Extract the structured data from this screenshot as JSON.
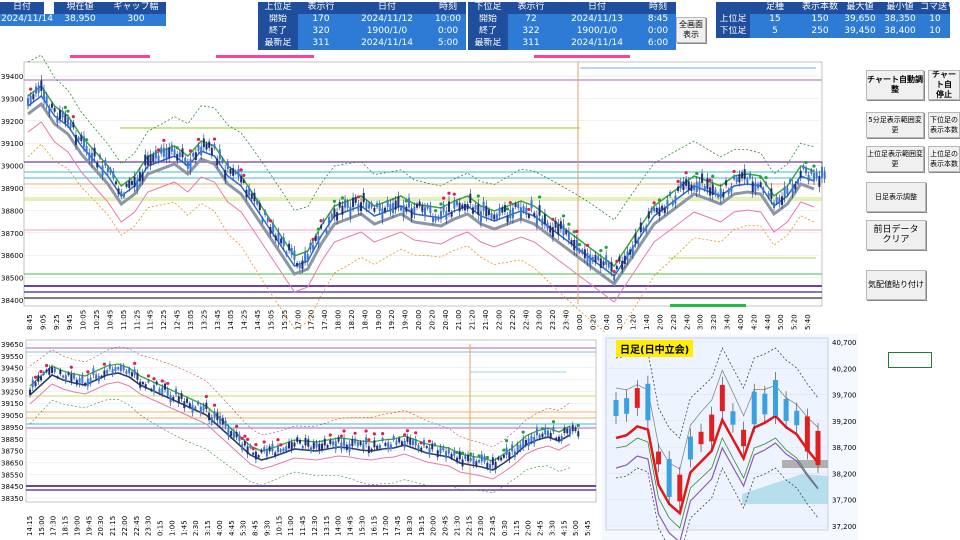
{
  "summary": {
    "headers": [
      "日付",
      "現在値",
      "ギャップ幅"
    ],
    "values": [
      "2024/11/14",
      "38,950",
      "300"
    ]
  },
  "upper": {
    "headers": [
      "上位足",
      "表示行",
      "日付",
      "時刻"
    ],
    "rows": [
      [
        "開始",
        "170",
        "2024/11/12",
        "10:00"
      ],
      [
        "終了",
        "320",
        "1900/1/0",
        "0:00"
      ],
      [
        "最新足",
        "311",
        "2024/11/14",
        "5:00"
      ]
    ]
  },
  "lower": {
    "headers": [
      "下位足",
      "表示行",
      "日付",
      "時刻"
    ],
    "rows": [
      [
        "開始",
        "72",
        "2024/11/13",
        "8:45"
      ],
      [
        "終了",
        "322",
        "1900/1/0",
        "0:00"
      ],
      [
        "最新足",
        "311",
        "2024/11/14",
        "6:00"
      ]
    ]
  },
  "fullscreen_button": [
    "全画面",
    "表示"
  ],
  "ashi": {
    "headers": [
      "足種",
      "表示本数",
      "最大値",
      "最小値",
      "コマ送り本数"
    ],
    "rows": [
      [
        "上位足",
        "15",
        "150",
        "39,650",
        "38,350",
        "10"
      ],
      [
        "下位足",
        "5",
        "250",
        "39,450",
        "38,400",
        "10"
      ]
    ]
  },
  "side_buttons": {
    "chart_auto": "チャート自動調整",
    "chart_auto_stop": [
      "チャート自",
      "停止"
    ],
    "range_5min": "5分足表示範囲変更",
    "lower_range": [
      "下位足の",
      "表示本数"
    ],
    "upper_range": "上位足表示範囲変更",
    "upper_range2": [
      "上位足の",
      "表示本数"
    ],
    "daily_adjust": "日足表示調整",
    "prev_day": [
      "前日データ",
      "クリア"
    ],
    "paste_quote": "気配値貼り付け"
  },
  "chart_top": {
    "y_ticks": [
      "39400",
      "39300",
      "39200",
      "39100",
      "39000",
      "38900",
      "38800",
      "38700",
      "38600",
      "38500",
      "38400"
    ],
    "x_ticks": [
      "8:45",
      "9:05",
      "9:25",
      "9:45",
      "10:05",
      "10:25",
      "10:45",
      "11:05",
      "11:25",
      "11:45",
      "12:25",
      "12:45",
      "13:05",
      "13:25",
      "13:45",
      "14:05",
      "14:25",
      "14:45",
      "15:05",
      "15:25",
      "17:00",
      "17:20",
      "17:40",
      "18:00",
      "18:20",
      "18:40",
      "19:00",
      "19:20",
      "19:40",
      "20:00",
      "20:20",
      "20:40",
      "21:00",
      "21:20",
      "21:40",
      "22:00",
      "22:20",
      "22:40",
      "23:00",
      "23:20",
      "23:40",
      "0:00",
      "0:20",
      "0:40",
      "1:00",
      "1:20",
      "1:40",
      "2:00",
      "2:20",
      "2:40",
      "3:00",
      "3:20",
      "3:40",
      "4:00",
      "4:20",
      "4:40",
      "5:00",
      "5:20",
      "5:40"
    ]
  },
  "chart_bottom": {
    "y_ticks": [
      "39650",
      "39550",
      "39450",
      "39350",
      "39250",
      "39150",
      "39050",
      "38950",
      "38850",
      "38750",
      "38650",
      "38550",
      "38450",
      "38350"
    ],
    "x_ticks": [
      "14:15",
      "15:00",
      "17:30",
      "18:15",
      "19:00",
      "19:45",
      "20:30",
      "21:15",
      "22:00",
      "22:45",
      "23:30",
      "0:15",
      "1:00",
      "1:45",
      "2:30",
      "3:15",
      "4:00",
      "4:45",
      "5:30",
      "8:45",
      "9:30",
      "10:15",
      "11:00",
      "11:45",
      "12:30",
      "13:15",
      "14:00",
      "14:45",
      "15:30",
      "16:15",
      "17:00",
      "17:45",
      "18:30",
      "19:15",
      "20:00",
      "20:45",
      "21:30",
      "22:15",
      "23:00",
      "23:45",
      "0:30",
      "1:15",
      "2:00",
      "2:45",
      "3:30",
      "4:15",
      "5:00",
      "5:45"
    ]
  },
  "daily_chart": {
    "title": "日足(日中立会)",
    "y_ticks": [
      "40,700",
      "40,200",
      "39,700",
      "39,200",
      "38,700",
      "38,200",
      "37,700",
      "37,200"
    ]
  },
  "colors": {
    "header": "#1f4e9c",
    "value": "#2e7bd6",
    "daily_title_bg": "#ffee00"
  }
}
